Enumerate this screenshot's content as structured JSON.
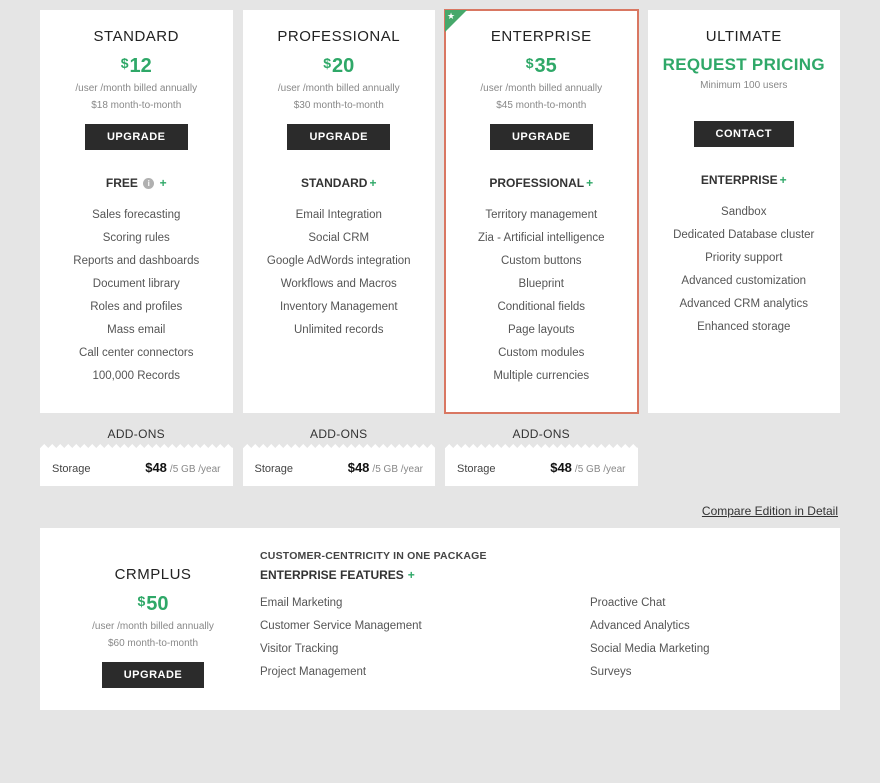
{
  "plans": [
    {
      "name": "STANDARD",
      "price": "12",
      "sub1": "/user /month billed annually",
      "sub2": "$18 month-to-month",
      "button": "UPGRADE",
      "includes": "FREE",
      "features": [
        "Sales forecasting",
        "Scoring rules",
        "Reports and dashboards",
        "Document library",
        "Roles and profiles",
        "Mass email",
        "Call center connectors",
        "100,000 Records"
      ]
    },
    {
      "name": "PROFESSIONAL",
      "price": "20",
      "sub1": "/user /month billed annually",
      "sub2": "$30 month-to-month",
      "button": "UPGRADE",
      "includes": "STANDARD",
      "features": [
        "Email Integration",
        "Social CRM",
        "Google AdWords integration",
        "Workflows and Macros",
        "Inventory Management",
        "Unlimited records"
      ]
    },
    {
      "name": "ENTERPRISE",
      "price": "35",
      "sub1": "/user /month billed annually",
      "sub2": "$45 month-to-month",
      "button": "UPGRADE",
      "includes": "PROFESSIONAL",
      "features": [
        "Territory management",
        "Zia - Artificial intelligence",
        "Custom buttons",
        "Blueprint",
        "Conditional fields",
        "Page layouts",
        "Custom modules",
        "Multiple currencies"
      ]
    },
    {
      "name": "ULTIMATE",
      "price_text": "REQUEST PRICING",
      "sub1": "Minimum 100 users",
      "button": "CONTACT",
      "includes": "ENTERPRISE",
      "features": [
        "Sandbox",
        "Dedicated Database cluster",
        "Priority support",
        "Advanced customization",
        "Advanced CRM analytics",
        "Enhanced storage"
      ]
    }
  ],
  "addons_title": "ADD-ONS",
  "addon": {
    "label": "Storage",
    "price": "$48",
    "unit": "/5 GB /year"
  },
  "compare_link": "Compare Edition in Detail",
  "crmplus": {
    "name": "CRMPLUS",
    "price": "50",
    "sub1": "/user /month billed annually",
    "sub2": "$60 month-to-month",
    "button": "UPGRADE",
    "heading1": "CUSTOMER-CENTRICITY IN ONE PACKAGE",
    "heading2": "ENTERPRISE FEATURES",
    "col1": [
      "Email Marketing",
      "Customer Service Management",
      "Visitor Tracking",
      "Project Management"
    ],
    "col2": [
      "Proactive Chat",
      "Advanced Analytics",
      "Social Media Marketing",
      "Surveys"
    ]
  }
}
